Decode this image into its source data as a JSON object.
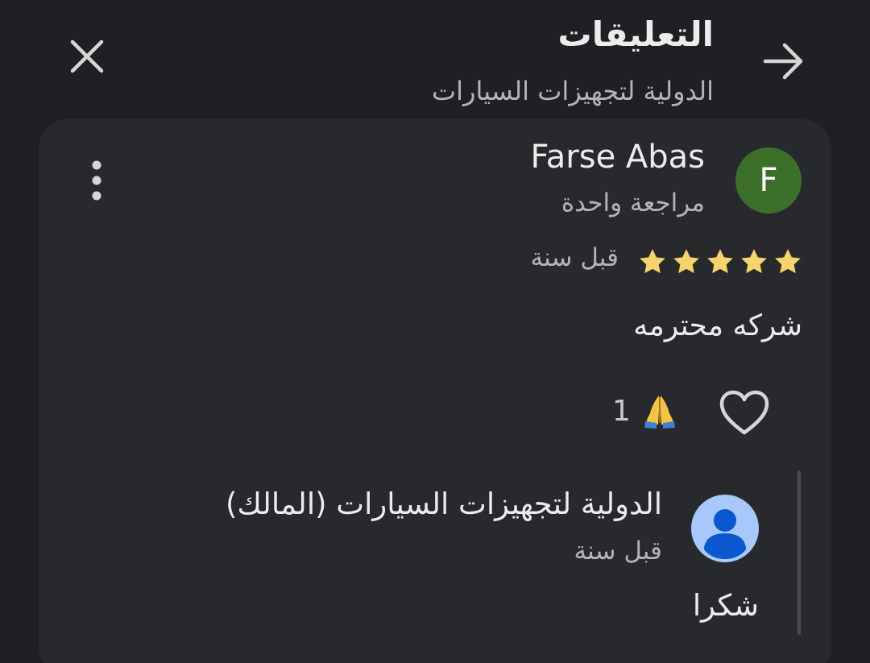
{
  "header": {
    "title": "التعليقات",
    "subtitle": "الدولية لتجهيزات السيارات",
    "back_icon": "arrow-right-icon",
    "close_icon": "close-icon"
  },
  "review": {
    "avatar_letter": "F",
    "avatar_color": "#3b6f2a",
    "reviewer_name": "Farse Abas",
    "review_count": "مراجعة واحدة",
    "rating": 5,
    "rating_max": 5,
    "star_color": "#f6d36b",
    "time": "قبل سنة",
    "text": "شركه محترمه",
    "reaction_count": "1",
    "reaction_icon": "folded-hands-emoji"
  },
  "owner_reply": {
    "name": "الدولية لتجهيزات السيارات (المالك)",
    "time": "قبل سنة",
    "text": "شكرا",
    "avatar_color": "#a8c7fa"
  }
}
